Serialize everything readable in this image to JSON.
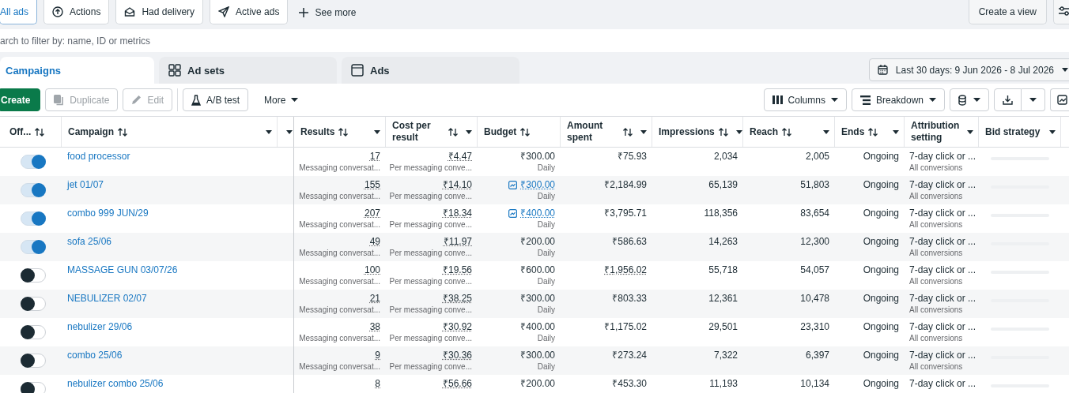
{
  "view_tabs": [
    {
      "label": "All ads",
      "selected": true
    },
    {
      "label": "Actions",
      "selected": false
    },
    {
      "label": "Had delivery",
      "selected": false
    },
    {
      "label": "Active ads",
      "selected": false
    }
  ],
  "see_more": "See more",
  "create_view": "Create a view",
  "search": {
    "placeholder": "arch to filter by: name, ID or metrics"
  },
  "level_tabs": [
    {
      "label": "Campaigns",
      "selected": true
    },
    {
      "label": "Ad sets",
      "selected": false
    },
    {
      "label": "Ads",
      "selected": false
    }
  ],
  "date_range": "Last 30 days: 9 Jun 2026 - 8 Jul 2026",
  "toolbar": {
    "create": "Create",
    "duplicate": "Duplicate",
    "edit": "Edit",
    "ab_test": "A/B test",
    "more": "More",
    "columns": "Columns",
    "breakdown": "Breakdown"
  },
  "columns": [
    {
      "label": "Off...",
      "sort": true,
      "menu": false
    },
    {
      "label": "Campaign",
      "sort": true,
      "menu": true
    },
    {
      "sort": false,
      "menu": true
    },
    {
      "label": "Results",
      "sort": true,
      "menu": true
    },
    {
      "label": "Cost per result",
      "sort": true,
      "menu": true
    },
    {
      "label": "Budget",
      "sort": true,
      "menu": false
    },
    {
      "label": "Amount spent",
      "sort": true,
      "menu": true
    },
    {
      "label": "Impressions",
      "sort": true,
      "menu": true
    },
    {
      "label": "Reach",
      "sort": true,
      "menu": true
    },
    {
      "label": "Ends",
      "sort": true,
      "menu": true
    },
    {
      "label": "Attribution setting",
      "sort": false,
      "menu": true
    },
    {
      "label": "Bid strategy",
      "sort": false,
      "menu": true
    }
  ],
  "rows": [
    {
      "on": true,
      "name": "food processor",
      "results": "17",
      "results_sub": "Messaging conversat...",
      "cost": "₹4.47",
      "cost_sub": "Per messaging conve...",
      "budget": "₹300.00",
      "budget_linked": false,
      "budget_sub": "Daily",
      "spent": "₹75.93",
      "spent_dotted": false,
      "impressions": "2,034",
      "reach": "2,005",
      "ends": "Ongoing",
      "attribution": "7-day click or ...",
      "attribution_sub": "All conversions"
    },
    {
      "on": true,
      "name": "jet 01/07",
      "results": "155",
      "results_sub": "Messaging conversat...",
      "cost": "₹14.10",
      "cost_sub": "Per messaging conve...",
      "budget": "₹300.00",
      "budget_linked": true,
      "budget_sub": "Daily",
      "spent": "₹2,184.99",
      "spent_dotted": false,
      "impressions": "65,139",
      "reach": "51,803",
      "ends": "Ongoing",
      "attribution": "7-day click or ...",
      "attribution_sub": "All conversions"
    },
    {
      "on": true,
      "name": "combo 999 JUN/29",
      "results": "207",
      "results_sub": "Messaging conversat...",
      "cost": "₹18.34",
      "cost_sub": "Per messaging conve...",
      "budget": "₹400.00",
      "budget_linked": true,
      "budget_sub": "Daily",
      "spent": "₹3,795.71",
      "spent_dotted": false,
      "impressions": "118,356",
      "reach": "83,654",
      "ends": "Ongoing",
      "attribution": "7-day click or ...",
      "attribution_sub": "All conversions"
    },
    {
      "on": true,
      "name": "sofa 25/06",
      "results": "49",
      "results_sub": "Messaging conversat...",
      "cost": "₹11.97",
      "cost_sub": "Per messaging conve...",
      "budget": "₹200.00",
      "budget_linked": false,
      "budget_sub": "Daily",
      "spent": "₹586.63",
      "spent_dotted": false,
      "impressions": "14,263",
      "reach": "12,300",
      "ends": "Ongoing",
      "attribution": "7-day click or ...",
      "attribution_sub": "All conversions"
    },
    {
      "on": false,
      "name": "MASSAGE GUN 03/07/26",
      "results": "100",
      "results_sub": "Messaging conversat...",
      "cost": "₹19.56",
      "cost_sub": "Per messaging conve...",
      "budget": "₹600.00",
      "budget_linked": false,
      "budget_sub": "Daily",
      "spent": "₹1,956.02",
      "spent_dotted": true,
      "impressions": "55,718",
      "reach": "54,057",
      "ends": "Ongoing",
      "attribution": "7-day click or ...",
      "attribution_sub": "All conversions"
    },
    {
      "on": false,
      "name": "NEBULIZER 02/07",
      "results": "21",
      "results_sub": "Messaging conversat...",
      "cost": "₹38.25",
      "cost_sub": "Per messaging conve...",
      "budget": "₹300.00",
      "budget_linked": false,
      "budget_sub": "Daily",
      "spent": "₹803.33",
      "spent_dotted": false,
      "impressions": "12,361",
      "reach": "10,478",
      "ends": "Ongoing",
      "attribution": "7-day click or ...",
      "attribution_sub": "All conversions"
    },
    {
      "on": false,
      "name": "nebulizer 29/06",
      "results": "38",
      "results_sub": "Messaging conversat...",
      "cost": "₹30.92",
      "cost_sub": "Per messaging conve...",
      "budget": "₹400.00",
      "budget_linked": false,
      "budget_sub": "Daily",
      "spent": "₹1,175.02",
      "spent_dotted": false,
      "impressions": "29,501",
      "reach": "23,310",
      "ends": "Ongoing",
      "attribution": "7-day click or ...",
      "attribution_sub": "All conversions"
    },
    {
      "on": false,
      "name": "combo 25/06",
      "results": "9",
      "results_sub": "Messaging conversat...",
      "cost": "₹30.36",
      "cost_sub": "Per messaging conve...",
      "budget": "₹300.00",
      "budget_linked": false,
      "budget_sub": "Daily",
      "spent": "₹273.24",
      "spent_dotted": false,
      "impressions": "7,322",
      "reach": "6,397",
      "ends": "Ongoing",
      "attribution": "7-day click or ...",
      "attribution_sub": "All conversions"
    },
    {
      "on": false,
      "name": "nebulizer combo 25/06",
      "results": "8",
      "cost": "₹56.66",
      "budget": "₹200.00",
      "budget_linked": false,
      "spent": "₹453.30",
      "spent_dotted": false,
      "impressions": "11,193",
      "reach": "10,134",
      "ends": "Ongoing",
      "attribution": "7-day click or ..."
    }
  ]
}
